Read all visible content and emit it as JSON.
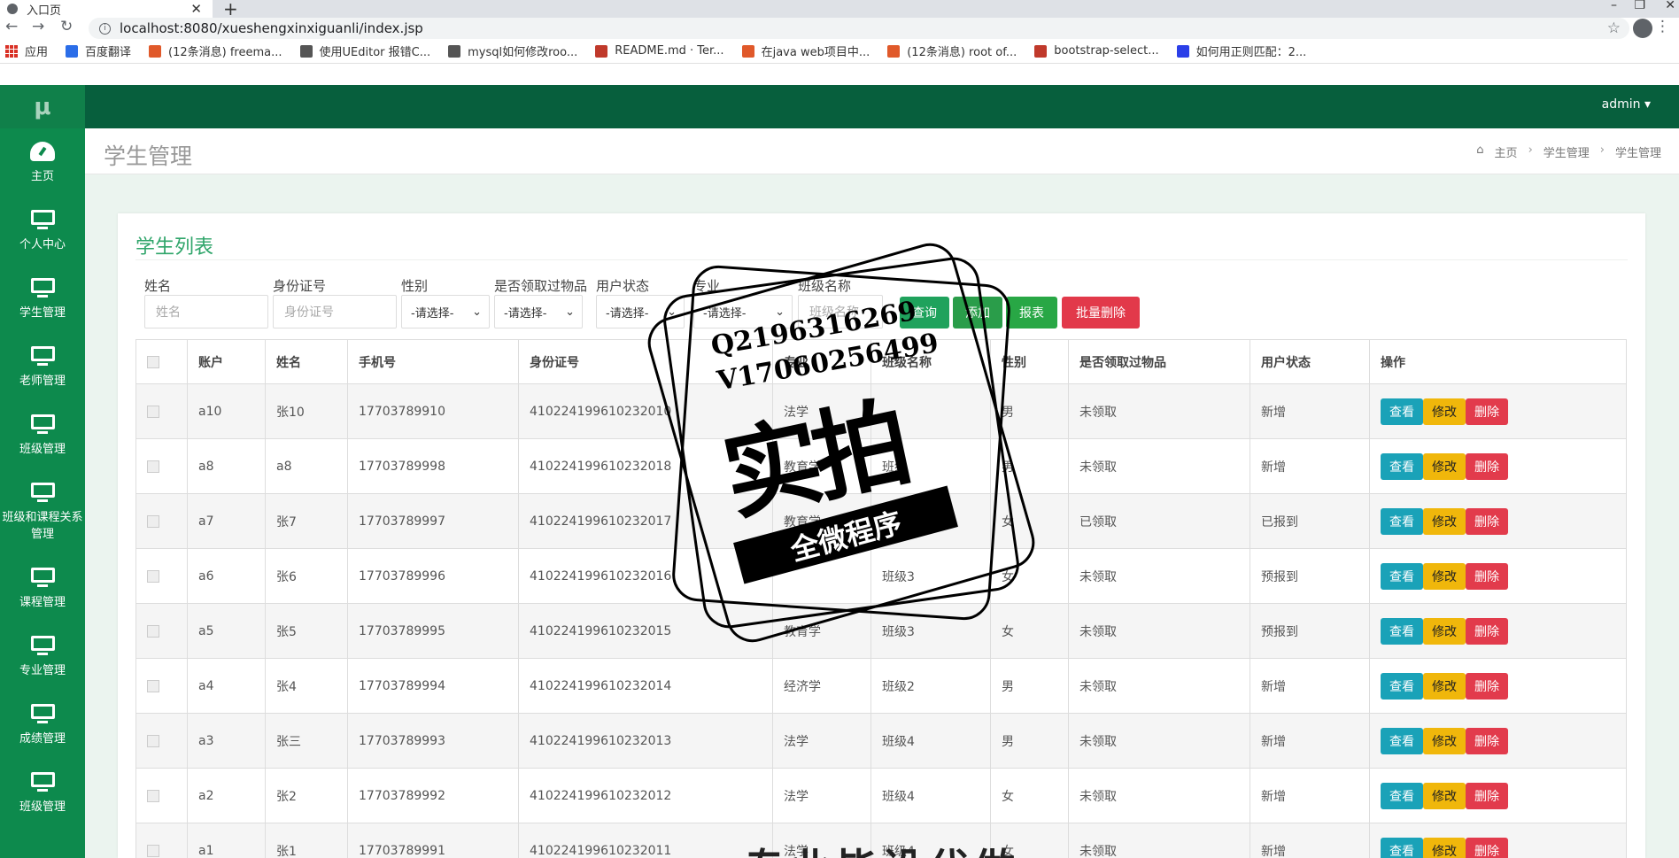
{
  "browser": {
    "tab_title": "入口页",
    "tab_close": "✕",
    "new_tab": "+",
    "url": "localhost:8080/xueshengxinxiguanli/index.jsp",
    "bookmarks": [
      {
        "label": "应用",
        "color": "#d93025"
      },
      {
        "label": "百度翻译",
        "color": "#2b6de8"
      },
      {
        "label": "(12条消息) freema...",
        "color": "#e0592a"
      },
      {
        "label": "使用UEditor 报错C...",
        "color": "#555555"
      },
      {
        "label": "mysql如何修改roo...",
        "color": "#555555"
      },
      {
        "label": "README.md · Ter...",
        "color": "#c0392b"
      },
      {
        "label": "在java web项目中...",
        "color": "#e0592a"
      },
      {
        "label": "(12条消息) root of...",
        "color": "#e0592a"
      },
      {
        "label": "bootstrap-select...",
        "color": "#c0392b"
      },
      {
        "label": "如何用正则匹配：2...",
        "color": "#2b3fe8"
      }
    ]
  },
  "app": {
    "logo": "μ",
    "user_menu": "admin ▾",
    "sidebar": [
      {
        "label": "主页",
        "icon": "dashboard-icon"
      },
      {
        "label": "个人中心",
        "icon": "monitor-icon"
      },
      {
        "label": "学生管理",
        "icon": "monitor-icon"
      },
      {
        "label": "老师管理",
        "icon": "monitor-icon"
      },
      {
        "label": "班级管理",
        "icon": "monitor-icon"
      },
      {
        "label": "班级和课程关系管理",
        "icon": "monitor-icon"
      },
      {
        "label": "课程管理",
        "icon": "monitor-icon"
      },
      {
        "label": "专业管理",
        "icon": "monitor-icon"
      },
      {
        "label": "成绩管理",
        "icon": "monitor-icon"
      },
      {
        "label": "班级管理",
        "icon": "monitor-icon"
      }
    ],
    "page_title": "学生管理",
    "breadcrumb": [
      "主页",
      "学生管理",
      "学生管理"
    ],
    "card_title": "学生列表",
    "filters": {
      "name_label": "姓名",
      "name_placeholder": "姓名",
      "id_label": "身份证号",
      "id_placeholder": "身份证号",
      "gender_label": "性别",
      "gender_value": "-请选择-",
      "gift_label": "是否领取过物品",
      "gift_value": "-请选择-",
      "status_label": "用户状态",
      "status_value": "-请选择-",
      "major_label": "专业",
      "major_value": "-请选择-",
      "class_label": "班级名称",
      "class_placeholder": "班级名称"
    },
    "buttons": {
      "query": "查询",
      "add": "添加",
      "report": "报表",
      "batch_delete": "批量删除"
    },
    "table": {
      "headers": [
        "账户",
        "姓名",
        "手机号",
        "身份证号",
        "专业",
        "班级名称",
        "性别",
        "是否领取过物品",
        "用户状态",
        "操作"
      ],
      "rows": [
        {
          "account": "a10",
          "name": "张10",
          "phone": "17703789910",
          "idno": "410224199610232010",
          "major": "法学",
          "class": "",
          "gender": "男",
          "gift": "未领取",
          "status": "新增"
        },
        {
          "account": "a8",
          "name": "a8",
          "phone": "17703789998",
          "idno": "410224199610232018",
          "major": "教育学",
          "class": "班级",
          "gender": "男",
          "gift": "未领取",
          "status": "新增"
        },
        {
          "account": "a7",
          "name": "张7",
          "phone": "17703789997",
          "idno": "410224199610232017",
          "major": "教育学",
          "class": "",
          "gender": "女",
          "gift": "已领取",
          "status": "已报到"
        },
        {
          "account": "a6",
          "name": "张6",
          "phone": "17703789996",
          "idno": "410224199610232016",
          "major": "",
          "class": "班级3",
          "gender": "女",
          "gift": "未领取",
          "status": "预报到"
        },
        {
          "account": "a5",
          "name": "张5",
          "phone": "17703789995",
          "idno": "410224199610232015",
          "major": "教育学",
          "class": "班级3",
          "gender": "女",
          "gift": "未领取",
          "status": "预报到"
        },
        {
          "account": "a4",
          "name": "张4",
          "phone": "17703789994",
          "idno": "410224199610232014",
          "major": "经济学",
          "class": "班级2",
          "gender": "男",
          "gift": "未领取",
          "status": "新增"
        },
        {
          "account": "a3",
          "name": "张三",
          "phone": "17703789993",
          "idno": "410224199610232013",
          "major": "法学",
          "class": "班级4",
          "gender": "男",
          "gift": "未领取",
          "status": "新增"
        },
        {
          "account": "a2",
          "name": "张2",
          "phone": "17703789992",
          "idno": "410224199610232012",
          "major": "法学",
          "class": "班级4",
          "gender": "女",
          "gift": "未领取",
          "status": "新增"
        },
        {
          "account": "a1",
          "name": "张1",
          "phone": "17703789991",
          "idno": "410224199610232011",
          "major": "法学",
          "class": "班级4",
          "gender": "女",
          "gift": "未领取",
          "status": "新增"
        }
      ],
      "actions": {
        "view": "查看",
        "edit": "修改",
        "delete": "删除"
      }
    }
  },
  "watermark": {
    "qq": "Q2196316269",
    "v": "V17060256499",
    "main": "实拍",
    "ribbon": "全微程序",
    "bottom": "专业毕设代做"
  }
}
